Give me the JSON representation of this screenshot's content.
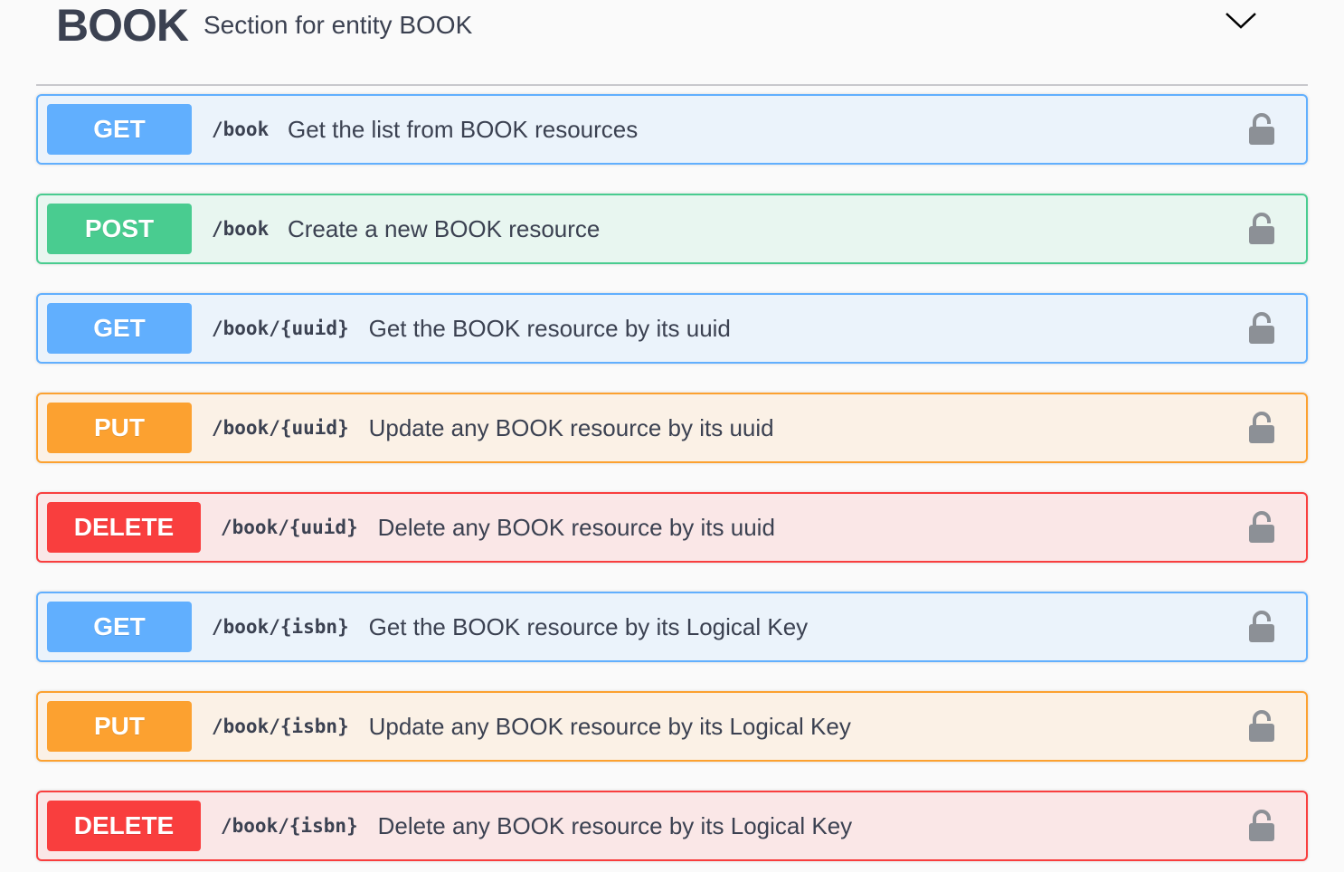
{
  "section": {
    "name": "BOOK",
    "description": "Section for entity BOOK"
  },
  "operations": [
    {
      "method": "GET",
      "path": "/book",
      "summary": "Get the list from BOOK resources",
      "kind": "get"
    },
    {
      "method": "POST",
      "path": "/book",
      "summary": "Create a new BOOK resource",
      "kind": "post"
    },
    {
      "method": "GET",
      "path": "/book/{uuid}",
      "summary": "Get the BOOK resource by its uuid",
      "kind": "get"
    },
    {
      "method": "PUT",
      "path": "/book/{uuid}",
      "summary": "Update any BOOK resource by its uuid",
      "kind": "put"
    },
    {
      "method": "DELETE",
      "path": "/book/{uuid}",
      "summary": "Delete any BOOK resource by its uuid",
      "kind": "delete"
    },
    {
      "method": "GET",
      "path": "/book/{isbn}",
      "summary": "Get the BOOK resource by its Logical Key",
      "kind": "get"
    },
    {
      "method": "PUT",
      "path": "/book/{isbn}",
      "summary": "Update any BOOK resource by its Logical Key",
      "kind": "put"
    },
    {
      "method": "DELETE",
      "path": "/book/{isbn}",
      "summary": "Delete any BOOK resource by its Logical Key",
      "kind": "delete"
    }
  ]
}
